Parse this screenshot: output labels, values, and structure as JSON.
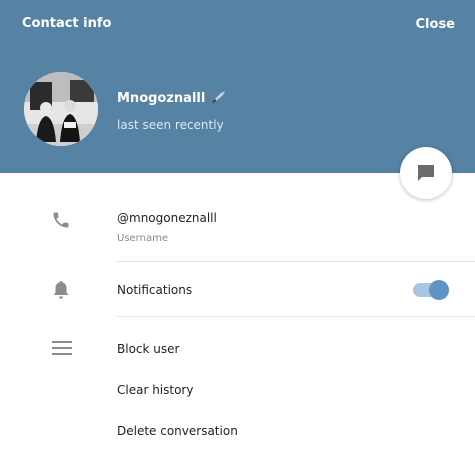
{
  "header": {
    "title": "Contact info",
    "close_label": "Close",
    "background_color": "#5682a3"
  },
  "profile": {
    "name": "Mnogoznalll",
    "name_emoji_icon": "knife-icon",
    "status": "last seen recently"
  },
  "details": {
    "username": "@mnogoneznalll",
    "username_label": "Username",
    "notifications_label": "Notifications",
    "notifications_enabled": true
  },
  "actions": {
    "block": "Block user",
    "clear": "Clear history",
    "delete": "Delete conversation"
  },
  "colors": {
    "toggle_track": "#a8c6de",
    "toggle_knob": "#5f93c4",
    "icon_gray": "#8c8c8c"
  }
}
